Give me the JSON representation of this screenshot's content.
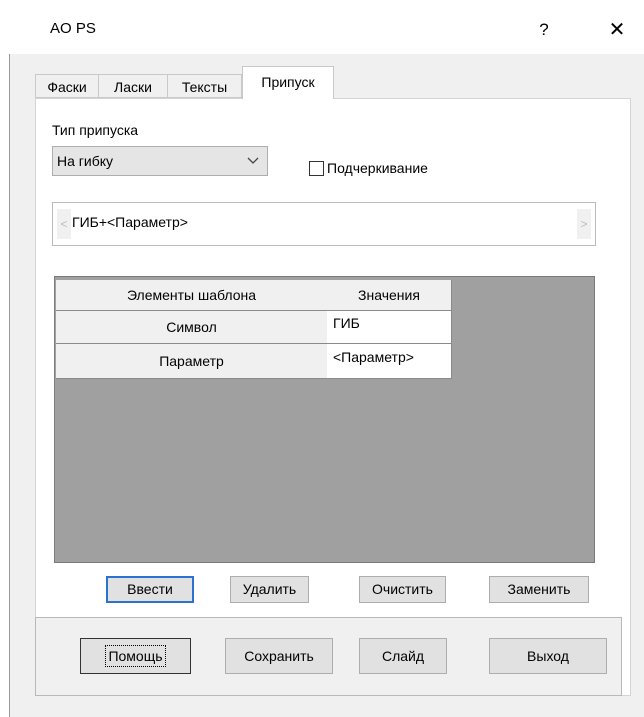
{
  "window": {
    "title": "AO PS",
    "help_label": "?",
    "close_label": "✕"
  },
  "tabs": [
    {
      "label": "Фаски",
      "active": false
    },
    {
      "label": "Ласки",
      "active": false
    },
    {
      "label": "Тексты",
      "active": false
    },
    {
      "label": "Припуск",
      "active": true
    }
  ],
  "allowance": {
    "type_label": "Тип припуска",
    "type_value": "На гибку",
    "underline_label": "Подчеркивание",
    "underline_checked": false,
    "template_text": "ГИБ+<Параметр>",
    "scroll_left": "<",
    "scroll_right": ">"
  },
  "grid": {
    "headers": [
      "Элементы шаблона",
      "Значения"
    ],
    "rows": [
      {
        "element": "Символ",
        "value": "ГИБ"
      },
      {
        "element": "Параметр",
        "value": "<Параметр>"
      }
    ]
  },
  "actions": {
    "enter": "Ввести",
    "delete": "Удалить",
    "clear": "Очистить",
    "replace": "Заменить"
  },
  "footer": {
    "help": "Помощь",
    "save": "Сохранить",
    "slide": "Слайд",
    "exit": "Выход"
  }
}
